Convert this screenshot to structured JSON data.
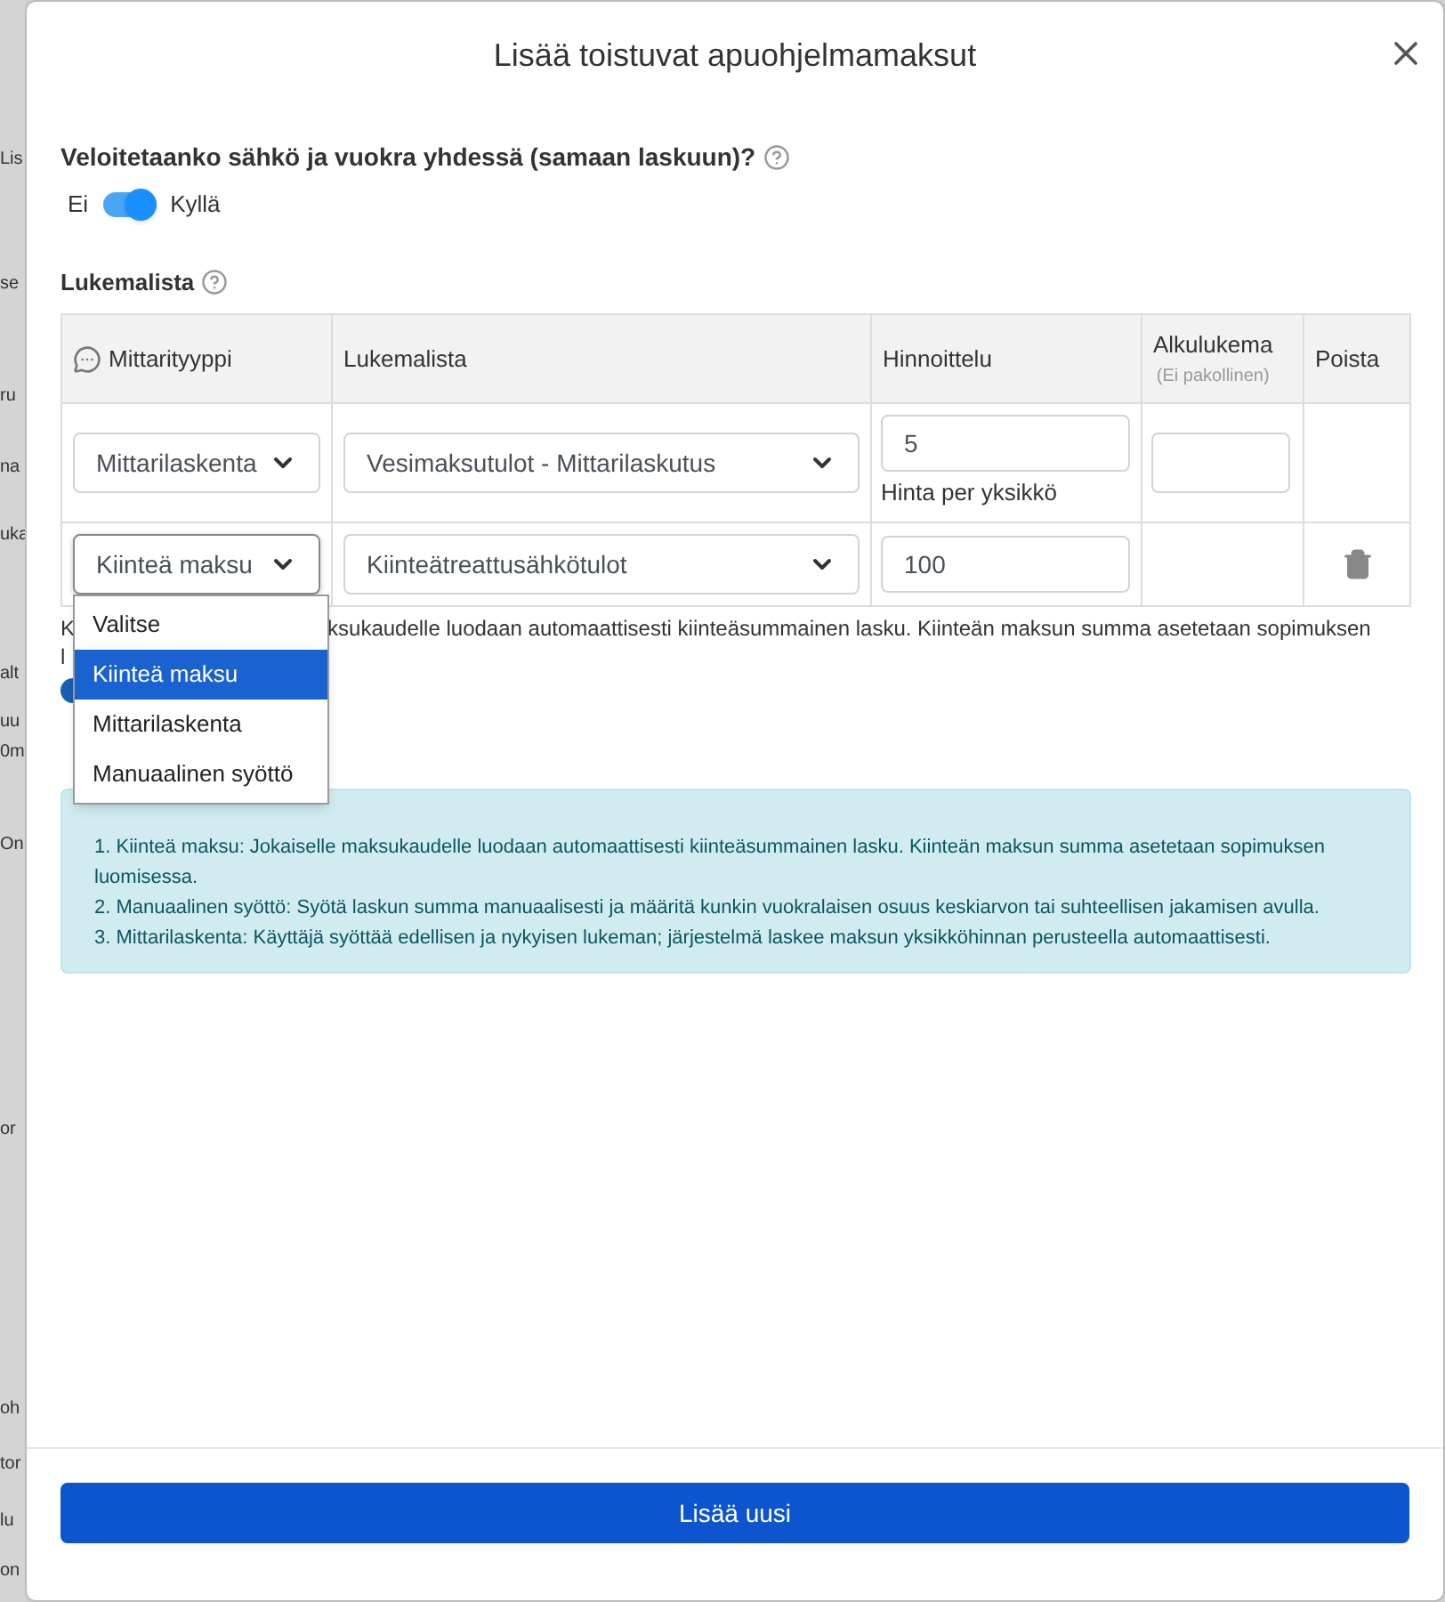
{
  "background_fragments": [
    "Lis",
    "se",
    "ru",
    "na",
    "uka",
    "alt",
    "uu",
    "0m",
    "On",
    "or",
    "oh",
    "tor",
    "lu",
    "on"
  ],
  "dialog": {
    "title": "Lisää toistuvat apuohjelmamaksut"
  },
  "combined_billing": {
    "question": "Veloitetaanko sähkö ja vuokra yhdessä (samaan laskuun)?",
    "off_label": "Ei",
    "on_label": "Kyllä",
    "on": true
  },
  "reading_list": {
    "label": "Lukemalista",
    "columns": [
      {
        "label": "Mittarityyppi"
      },
      {
        "label": "Lukemalista"
      },
      {
        "label": "Hinnoittelu"
      },
      {
        "label": "Alkulukema",
        "note": "(Ei pakollinen)"
      },
      {
        "label": "Poista"
      }
    ],
    "rows": [
      {
        "meter_type": "Mittarilaskenta",
        "reading_list": "Vesimaksutulot - Mittarilaskutus",
        "price": "5",
        "price_note": "Hinta per yksikkö",
        "initial_reading_field": true,
        "deletable": false,
        "focused": false
      },
      {
        "meter_type": "Kiinteä maksu",
        "reading_list": "Kiinteätreattusähkötulot",
        "price": "100",
        "initial_reading_field": false,
        "deletable": true,
        "focused": true
      }
    ]
  },
  "hint": {
    "first_letter": "K",
    "visible_text": "ksukaudelle luodaan automaattisesti kiinteäsummainen lasku. Kiinteän maksun summa asetetaan sopimuksen",
    "second_line": "l"
  },
  "dropdown": {
    "options": [
      {
        "label": "Valitse",
        "selected": false
      },
      {
        "label": "Kiinteä maksu",
        "selected": true
      },
      {
        "label": "Mittarilaskenta",
        "selected": false
      },
      {
        "label": "Manuaalinen syöttö",
        "selected": false
      }
    ]
  },
  "info": [
    "1. Kiinteä maksu: Jokaiselle maksukaudelle luodaan automaattisesti kiinteäsummainen lasku. Kiinteän maksun summa asetetaan sopimuksen luomisessa.",
    "2. Manuaalinen syöttö: Syötä laskun summa manuaalisesti ja määritä kunkin vuokralaisen osuus keskiarvon tai suhteellisen jakamisen avulla.",
    "3. Mittarilaskenta: Käyttäjä syöttää edellisen ja nykyisen lukeman; järjestelmä laskee maksun yksikköhinnan perusteella automaattisesti."
  ],
  "add_button": "Lisää uusi"
}
